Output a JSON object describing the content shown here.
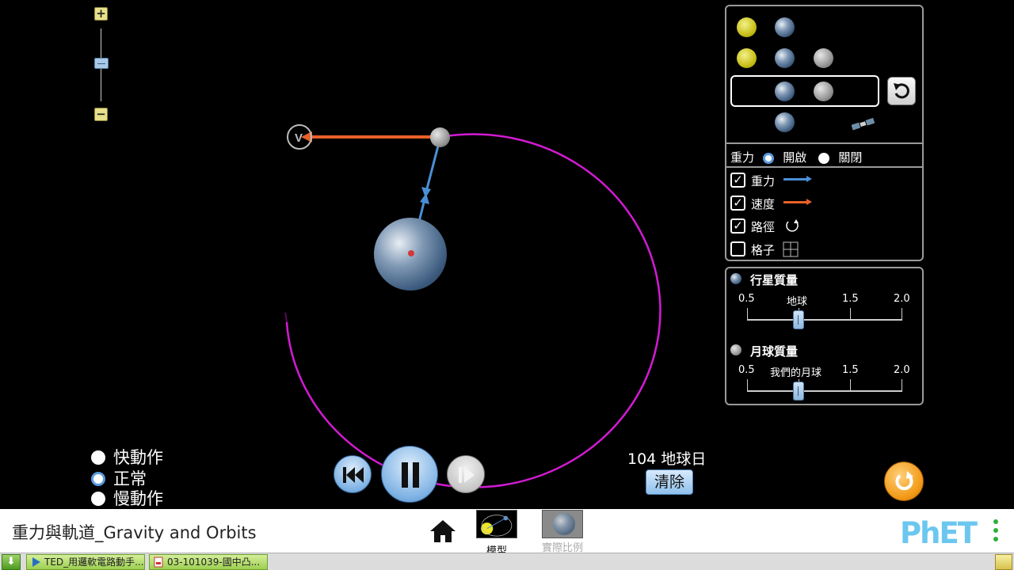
{
  "zoom": {
    "plus": "+",
    "minus": "−",
    "level": 0.55
  },
  "scene": {
    "reset_icon": "reset-arrow-icon",
    "selected_index": 2
  },
  "gravity_toggle": {
    "label": "重力",
    "on_label": "開啟",
    "off_label": "關閉",
    "value": "on"
  },
  "checkboxes": [
    {
      "label": "重力",
      "checked": true,
      "indicator": "gravity-arrow-icon",
      "color": "#4a8fd6"
    },
    {
      "label": "速度",
      "checked": true,
      "indicator": "velocity-arrow-icon",
      "color": "#e8602a"
    },
    {
      "label": "路徑",
      "checked": true,
      "indicator": "path-icon"
    },
    {
      "label": "格子",
      "checked": false,
      "indicator": "grid-icon"
    }
  ],
  "sliders": [
    {
      "title": "行星質量",
      "ticks": [
        "0.5",
        "地球",
        "1.5",
        "2.0"
      ],
      "value": 1.0,
      "min": 0.5,
      "max": 2.0
    },
    {
      "title": "月球質量",
      "ticks": [
        "0.5",
        "我們的月球",
        "1.5",
        "2.0"
      ],
      "value": 1.0,
      "min": 0.5,
      "max": 2.0
    }
  ],
  "speed": {
    "options": [
      "快動作",
      "正常",
      "慢動作"
    ],
    "selected": "正常"
  },
  "playback": {
    "state": "playing"
  },
  "vector_label": "V",
  "elapsed": {
    "value": "104",
    "unit": "地球日"
  },
  "clear_label": "清除",
  "navbar": {
    "title": "重力與軌道_Gravity and Orbits",
    "screens": [
      {
        "label": "模型",
        "selected": true
      },
      {
        "label": "實際比例",
        "selected": false
      }
    ],
    "logo": "PhET"
  },
  "taskbar": {
    "tasks": [
      {
        "label": "TED_用邏軟電路動手..."
      },
      {
        "label": "03-101039-國中凸..."
      }
    ]
  },
  "colors": {
    "path": "#d21bd2",
    "velocity": "#e8602a",
    "gravity": "#4a8fd6",
    "panel_border": "#9a9a9a"
  }
}
